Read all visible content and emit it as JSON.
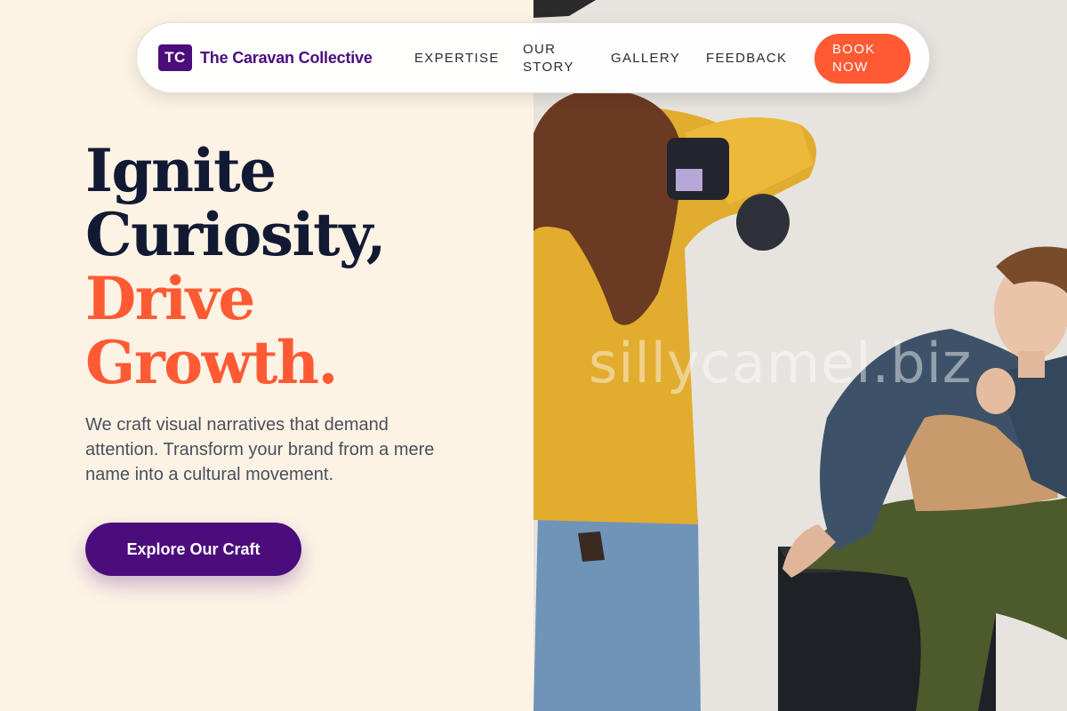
{
  "brand": {
    "badge": "TC",
    "name": "The Caravan Collective"
  },
  "nav": {
    "links": [
      "EXPERTISE",
      "OUR STORY",
      "GALLERY",
      "FEEDBACK"
    ],
    "cta": "BOOK NOW"
  },
  "hero": {
    "title_line1": "Ignite",
    "title_line2": "Curiosity,",
    "title_line3": "Drive",
    "title_line4": "Growth.",
    "subtitle": "We craft visual narratives that demand attention. Transform your brand from a mere name into a cultural movement.",
    "cta": "Explore Our Craft"
  },
  "watermark": "sillycamel.biz",
  "colors": {
    "brand_purple": "#4b0d7c",
    "accent_orange": "#ff5a33",
    "background_cream": "#fdf3e5",
    "heading_dark": "#121a33"
  }
}
